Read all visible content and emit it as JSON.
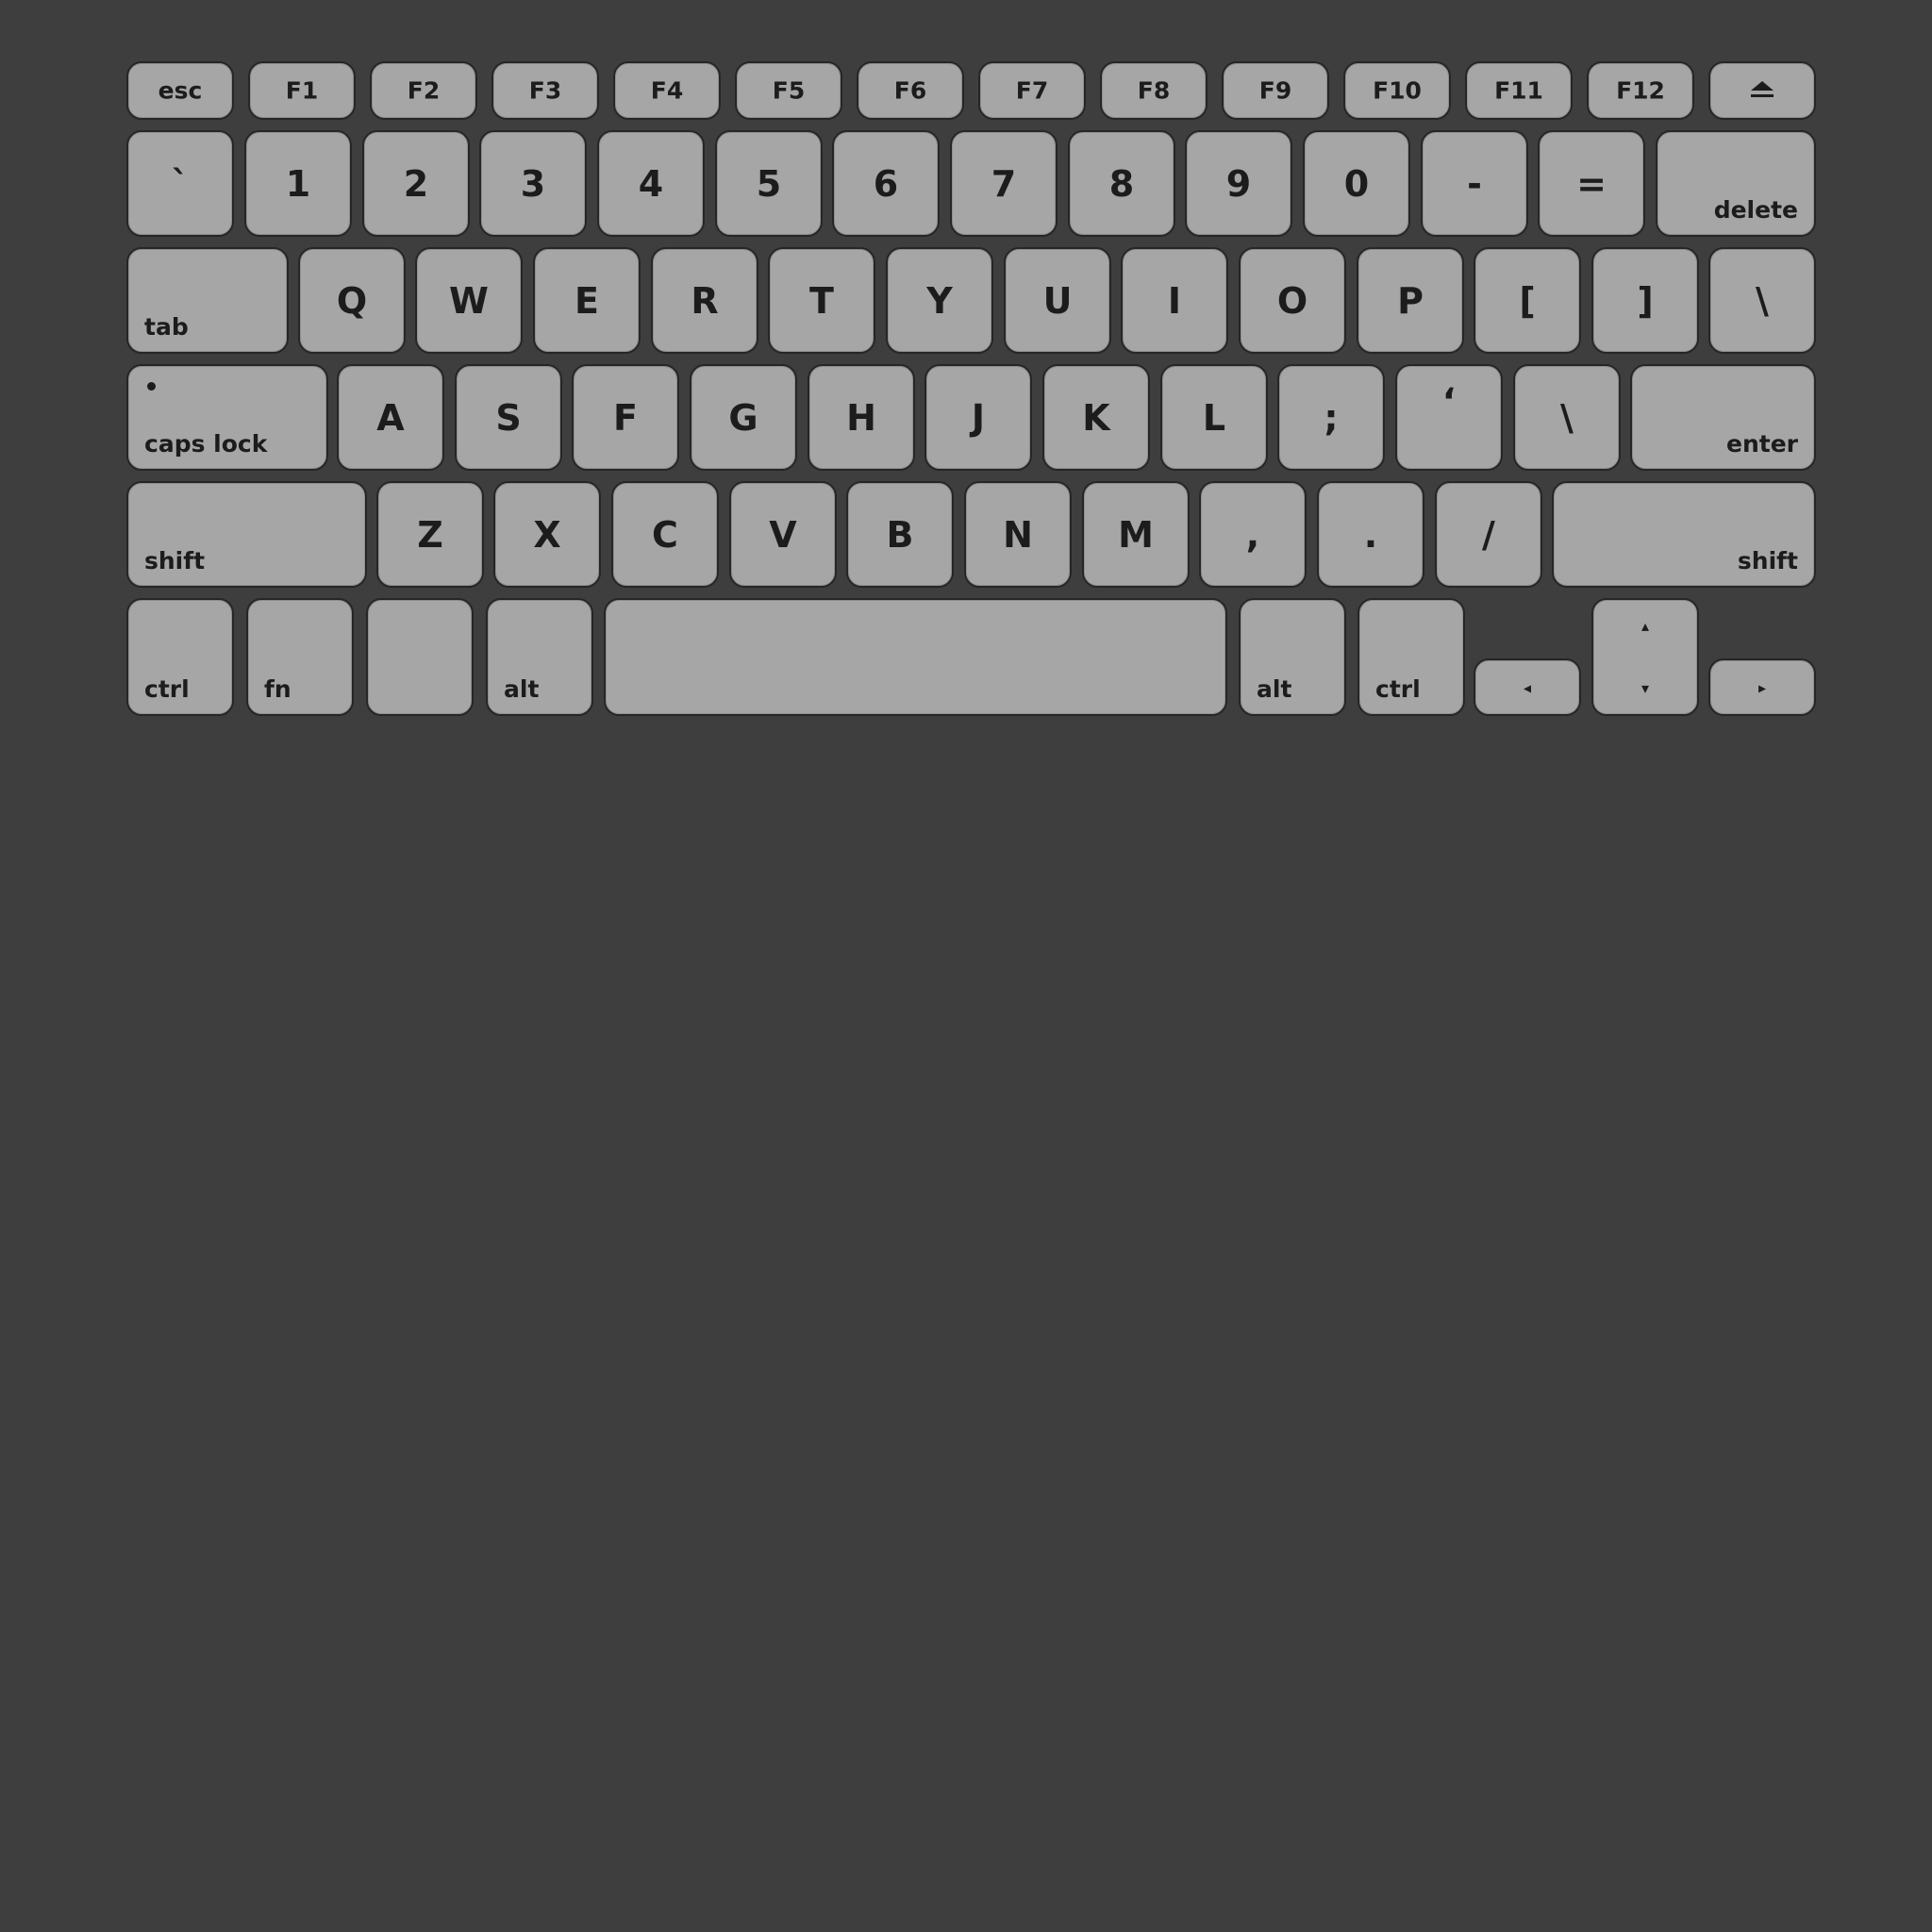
{
  "keyboard": {
    "fn_row": {
      "esc": "esc",
      "f1": "F1",
      "f2": "F2",
      "f3": "F3",
      "f4": "F4",
      "f5": "F5",
      "f6": "F6",
      "f7": "F7",
      "f8": "F8",
      "f9": "F9",
      "f10": "F10",
      "f11": "F11",
      "f12": "F12",
      "eject_icon": "eject-icon"
    },
    "number_row": {
      "backtick": "`",
      "n1": "1",
      "n2": "2",
      "n3": "3",
      "n4": "4",
      "n5": "5",
      "n6": "6",
      "n7": "7",
      "n8": "8",
      "n9": "9",
      "n0": "0",
      "minus": "-",
      "equals": "=",
      "delete": "delete"
    },
    "top_row": {
      "tab": "tab",
      "q": "Q",
      "w": "W",
      "e": "E",
      "r": "R",
      "t": "T",
      "y": "Y",
      "u": "U",
      "i": "I",
      "o": "O",
      "p": "P",
      "lbracket": "[",
      "rbracket": "]",
      "backslash": "\\"
    },
    "home_row": {
      "caps_lock": "caps lock",
      "caps_indicator_icon": "caps-lock-indicator-dot",
      "a": "A",
      "s": "S",
      "f": "F",
      "g": "G",
      "h": "H",
      "j": "J",
      "k": "K",
      "l": "L",
      "semicolon": ";",
      "quote": "‘",
      "backslash": "\\",
      "enter": "enter"
    },
    "bottom_row": {
      "lshift": "shift",
      "z": "Z",
      "x": "X",
      "c": "C",
      "v": "V",
      "b": "B",
      "n": "N",
      "m": "M",
      "comma": ",",
      "period": ".",
      "slash": "/",
      "rshift": "shift"
    },
    "modifier_row": {
      "lctrl": "ctrl",
      "fn": "fn",
      "lalt": "alt",
      "ralt": "alt",
      "rctrl": "ctrl",
      "arrow_left": "◂",
      "arrow_up": "▴",
      "arrow_down": "▾",
      "arrow_right": "▸"
    },
    "colors": {
      "background": "#3e3e3e",
      "key_face": "#a6a6a6",
      "key_border": "#262626",
      "legend": "#1c1c1c"
    }
  }
}
